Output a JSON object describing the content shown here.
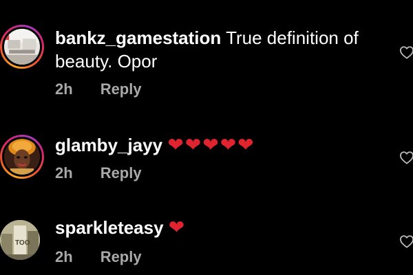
{
  "comments": [
    {
      "username": "bankz_gamestation",
      "text": "True definition of",
      "text_line2": "beauty. Opor",
      "time": "2h",
      "reply_label": "Reply",
      "avatar_style": "story-ring"
    },
    {
      "username": "glamby_jayy",
      "text": "❤❤❤❤❤",
      "time": "2h",
      "reply_label": "Reply",
      "avatar_style": "story-ring"
    },
    {
      "username": "sparkleteasy",
      "text": "❤",
      "time": "2h",
      "reply_label": "Reply",
      "avatar_style": "plain"
    }
  ],
  "icons": {
    "like": "heart-outline-icon"
  },
  "colors": {
    "background": "#000000",
    "text": "#ffffff",
    "meta": "#a8a8a8",
    "heart_emoji": "#e0242f",
    "ring_start": "#f9a825",
    "ring_end": "#d6246e"
  }
}
